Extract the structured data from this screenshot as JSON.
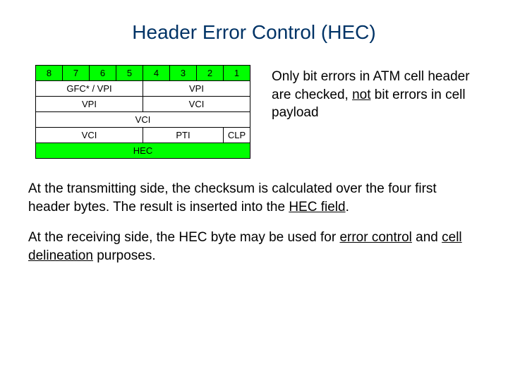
{
  "title": "Header Error Control (HEC)",
  "bits": {
    "b8": "8",
    "b7": "7",
    "b6": "6",
    "b5": "5",
    "b4": "4",
    "b3": "3",
    "b2": "2",
    "b1": "1"
  },
  "rows": {
    "r1a": "GFC* / VPI",
    "r1b": "VPI",
    "r2a": "VPI",
    "r2b": "VCI",
    "r3": "VCI",
    "r4a": "VCI",
    "r4b": "PTI",
    "r4c": "CLP",
    "r5": "HEC"
  },
  "side": {
    "p1": "Only bit errors in ATM cell header are checked, ",
    "not": "not",
    "p2": " bit errors in cell payload"
  },
  "para1": {
    "t1": "At the transmitting side, the checksum is calculated over the four first header bytes. The result is inserted into the ",
    "hec": "HEC field",
    "t2": "."
  },
  "para2": {
    "t1": "At the receiving side, the HEC byte may be used for ",
    "ec": "error control",
    "t2": " and ",
    "cd": "cell delineation",
    "t3": " purposes."
  }
}
